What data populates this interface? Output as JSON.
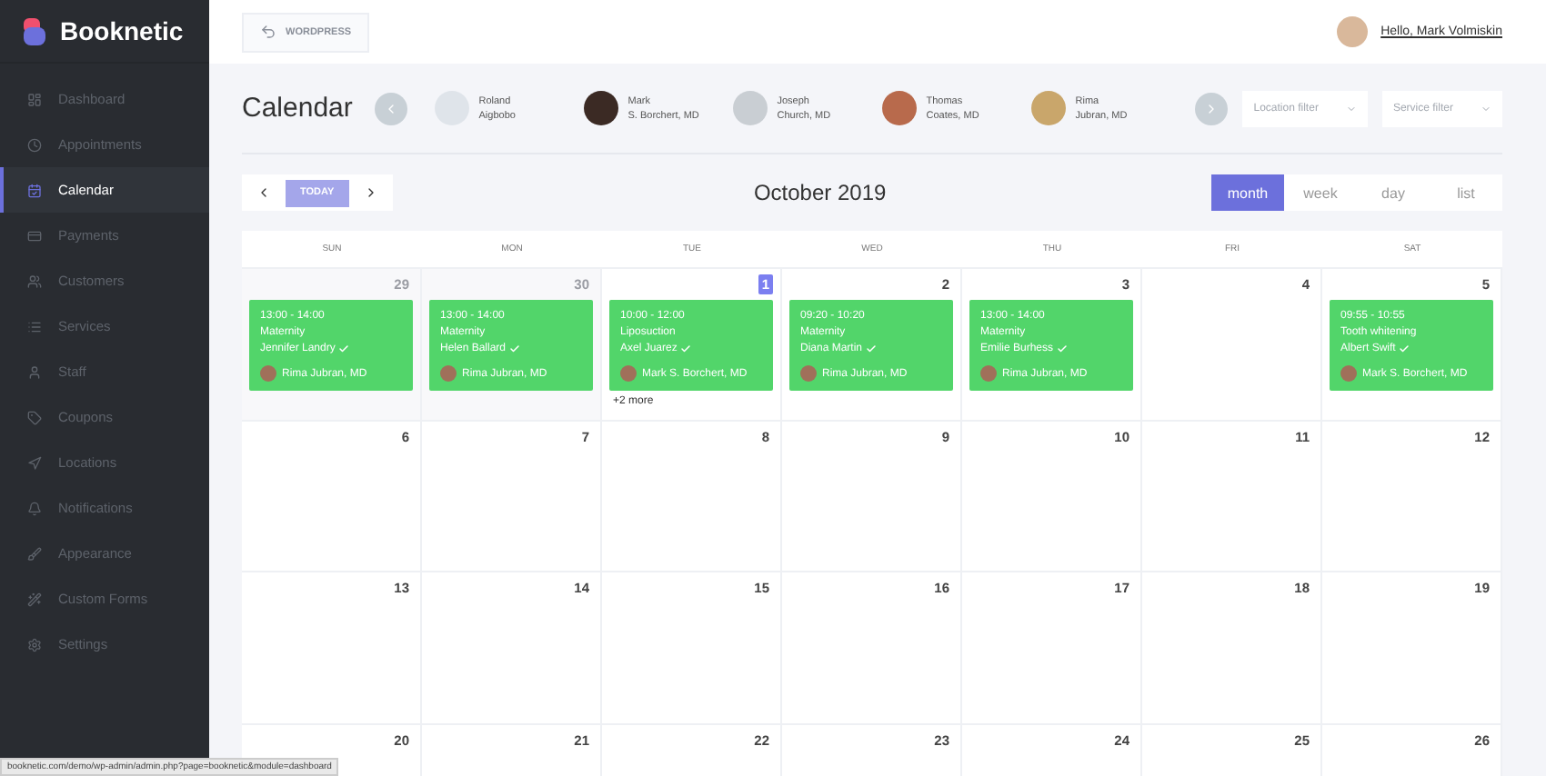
{
  "brand": "Booknetic",
  "sidebar": {
    "items": [
      {
        "label": "Dashboard",
        "selected": false
      },
      {
        "label": "Appointments",
        "selected": false
      },
      {
        "label": "Calendar",
        "selected": true
      },
      {
        "label": "Payments",
        "selected": false
      },
      {
        "label": "Customers",
        "selected": false
      },
      {
        "label": "Services",
        "selected": false
      },
      {
        "label": "Staff",
        "selected": false
      },
      {
        "label": "Coupons",
        "selected": false
      },
      {
        "label": "Locations",
        "selected": false
      },
      {
        "label": "Notifications",
        "selected": false
      },
      {
        "label": "Appearance",
        "selected": false
      },
      {
        "label": "Custom Forms",
        "selected": false
      },
      {
        "label": "Settings",
        "selected": false
      }
    ]
  },
  "topbar": {
    "back_button": "WORDPRESS",
    "greeting": "Hello, Mark Volmiskin"
  },
  "page_title": "Calendar",
  "staff": [
    {
      "first": "Roland",
      "second": "Aigbobo"
    },
    {
      "first": "Mark",
      "second": "S. Borchert, MD"
    },
    {
      "first": "Joseph",
      "second": "Church, MD"
    },
    {
      "first": "Thomas",
      "second": "Coates, MD"
    },
    {
      "first": "Rima",
      "second": "Jubran, MD"
    }
  ],
  "filters": [
    {
      "placeholder": "Location filter"
    },
    {
      "placeholder": "Service filter"
    }
  ],
  "toolbar": {
    "today": "TODAY",
    "month_title": "October 2019",
    "views": [
      {
        "label": "month",
        "selected": true
      },
      {
        "label": "week",
        "selected": false
      },
      {
        "label": "day",
        "selected": false
      },
      {
        "label": "list",
        "selected": false
      }
    ]
  },
  "weekdays": [
    "SUN",
    "MON",
    "TUE",
    "WED",
    "THU",
    "FRI",
    "SAT"
  ],
  "weeks": [
    [
      {
        "label": "29",
        "other_month": true,
        "today": false,
        "events": [
          {
            "time": "13:00 - 14:00",
            "service": "Maternity",
            "customer": "Jennifer Landry",
            "staff": "Rima Jubran, MD"
          }
        ]
      },
      {
        "label": "30",
        "other_month": true,
        "today": false,
        "events": [
          {
            "time": "13:00 - 14:00",
            "service": "Maternity",
            "customer": "Helen Ballard",
            "staff": "Rima Jubran, MD"
          }
        ]
      },
      {
        "label": "1",
        "other_month": false,
        "today": true,
        "events": [
          {
            "time": "10:00 - 12:00",
            "service": "Liposuction",
            "customer": "Axel Juarez",
            "staff": "Mark S. Borchert, MD"
          }
        ],
        "more": "+2 more"
      },
      {
        "label": "2",
        "other_month": false,
        "today": false,
        "events": [
          {
            "time": "09:20 - 10:20",
            "service": "Maternity",
            "customer": "Diana Martin",
            "staff": "Rima Jubran, MD"
          }
        ]
      },
      {
        "label": "3",
        "other_month": false,
        "today": false,
        "events": [
          {
            "time": "13:00 - 14:00",
            "service": "Maternity",
            "customer": "Emilie Burhess",
            "staff": "Rima Jubran, MD"
          }
        ]
      },
      {
        "label": "4",
        "other_month": false,
        "today": false
      },
      {
        "label": "5",
        "other_month": false,
        "today": false,
        "events": [
          {
            "time": "09:55 - 10:55",
            "service": "Tooth whitening",
            "customer": "Albert Swift",
            "staff": "Mark S. Borchert, MD"
          }
        ]
      }
    ],
    [
      {
        "label": "6"
      },
      {
        "label": "7"
      },
      {
        "label": "8"
      },
      {
        "label": "9"
      },
      {
        "label": "10"
      },
      {
        "label": "11"
      },
      {
        "label": "12"
      }
    ],
    [
      {
        "label": "13"
      },
      {
        "label": "14"
      },
      {
        "label": "15"
      },
      {
        "label": "16"
      },
      {
        "label": "17"
      },
      {
        "label": "18"
      },
      {
        "label": "19"
      }
    ],
    [
      {
        "label": "20"
      },
      {
        "label": "21"
      },
      {
        "label": "22"
      },
      {
        "label": "23"
      },
      {
        "label": "24"
      },
      {
        "label": "25"
      },
      {
        "label": "26"
      }
    ]
  ],
  "status_url": "booknetic.com/demo/wp-admin/admin.php?page=booknetic&module=dashboard"
}
